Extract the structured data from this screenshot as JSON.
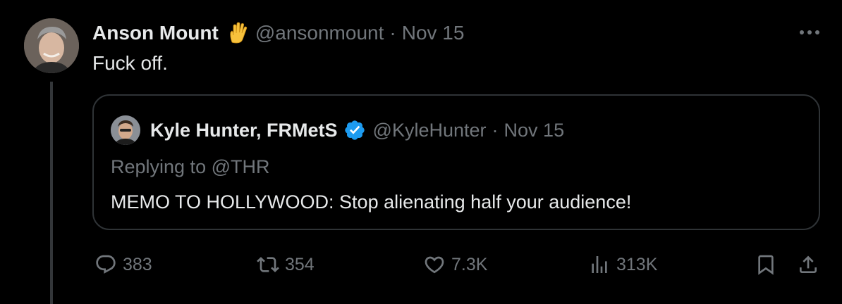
{
  "tweet": {
    "author_name": "Anson Mount",
    "emoji": "vulcan-salute",
    "handle": "@ansonmount",
    "separator": "·",
    "date": "Nov 15",
    "text": "Fuck off."
  },
  "quoted": {
    "author_name": "Kyle Hunter, FRMetS",
    "verified": true,
    "handle": "@KyleHunter",
    "separator": "·",
    "date": "Nov 15",
    "replying_to": "Replying to @THR",
    "text": "MEMO TO HOLLYWOOD: Stop alienating half your audience!"
  },
  "actions": {
    "replies": "383",
    "reposts": "354",
    "likes": "7.3K",
    "views": "313K"
  },
  "colors": {
    "background": "#000000",
    "primary_text": "#e7e9ea",
    "secondary_text": "#71767b",
    "border": "#2f3336",
    "verified": "#1d9bf0"
  }
}
